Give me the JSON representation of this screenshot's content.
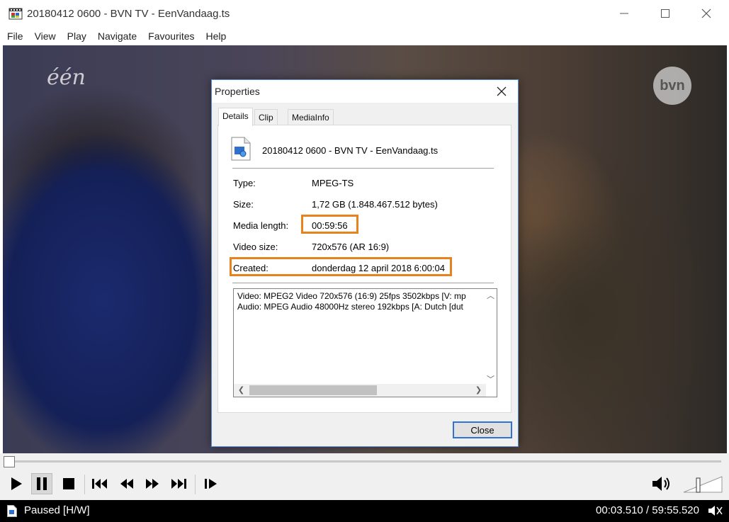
{
  "window": {
    "title": "20180412 0600 - BVN TV - EenVandaag.ts"
  },
  "menu": [
    "File",
    "View",
    "Play",
    "Navigate",
    "Favourites",
    "Help"
  ],
  "video": {
    "logo_left": "één",
    "logo_right": "bvn"
  },
  "dialog": {
    "title": "Properties",
    "tabs": [
      "Details",
      "Clip",
      "MediaInfo"
    ],
    "selected_tab": "Details",
    "file_name": "20180412 0600 - BVN TV - EenVandaag.ts",
    "properties": [
      {
        "label": "Type:",
        "value": "MPEG-TS"
      },
      {
        "label": "Size:",
        "value": "1,72 GB (1.848.467.512 bytes)"
      },
      {
        "label": "Media length:",
        "value": "00:59:56"
      },
      {
        "label": "Video size:",
        "value": "720x576 (AR 16:9)"
      },
      {
        "label": "Created:",
        "value": "donderdag 12 april 2018 6:00:04"
      }
    ],
    "info_lines": [
      "Video: MPEG2 Video 720x576 (16:9) 25fps 3502kbps [V: mp",
      "Audio: MPEG Audio 48000Hz stereo 192kbps [A: Dutch [dut"
    ],
    "close_label": "Close",
    "highlight_color": "#e8821e"
  },
  "status": {
    "state": "Paused [H/W]",
    "time": "00:03.510 / 59:55.520"
  }
}
